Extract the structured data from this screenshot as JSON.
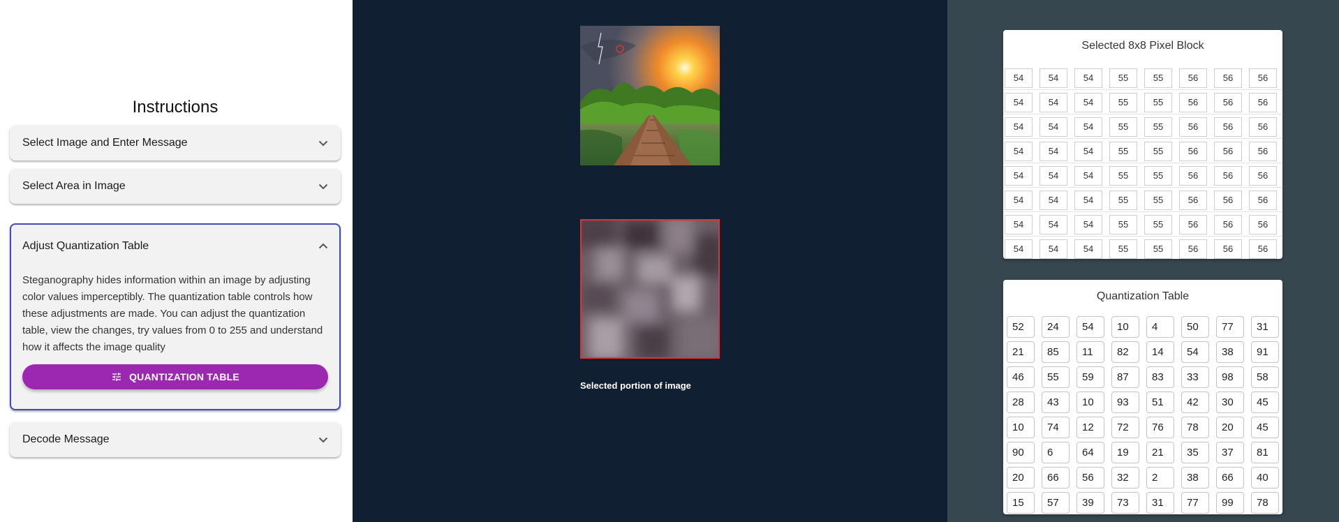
{
  "instructions": {
    "title": "Instructions",
    "sections": [
      {
        "label": "Select Image and Enter Message",
        "expanded": false
      },
      {
        "label": "Select Area in Image",
        "expanded": false
      },
      {
        "label": "Adjust Quantization Table",
        "expanded": true,
        "body": "Steganography hides information within an image by adjusting color values imperceptibly. The quantization table controls how these adjustments are made. You can adjust the quantization table, view the changes, try values from 0 to 255 and understand how it affects the image quality",
        "button_label": "QUANTIZATION TABLE",
        "button_icon": "tune-icon"
      },
      {
        "label": "Decode Message",
        "expanded": false
      }
    ]
  },
  "viewer": {
    "selected_caption": "Selected portion of image"
  },
  "pixel_block": {
    "title": "Selected 8x8 Pixel Block",
    "rows": [
      [
        54,
        54,
        54,
        55,
        55,
        56,
        56,
        56
      ],
      [
        54,
        54,
        54,
        55,
        55,
        56,
        56,
        56
      ],
      [
        54,
        54,
        54,
        55,
        55,
        56,
        56,
        56
      ],
      [
        54,
        54,
        54,
        55,
        55,
        56,
        56,
        56
      ],
      [
        54,
        54,
        54,
        55,
        55,
        56,
        56,
        56
      ],
      [
        54,
        54,
        54,
        55,
        55,
        56,
        56,
        56
      ],
      [
        54,
        54,
        54,
        55,
        55,
        56,
        56,
        56
      ],
      [
        54,
        54,
        54,
        55,
        55,
        56,
        56,
        56
      ]
    ]
  },
  "quantization_table": {
    "title": "Quantization Table",
    "rows": [
      [
        52,
        24,
        54,
        10,
        4,
        50,
        77,
        31
      ],
      [
        21,
        85,
        11,
        82,
        14,
        54,
        38,
        91
      ],
      [
        46,
        55,
        59,
        87,
        83,
        33,
        98,
        58
      ],
      [
        28,
        43,
        10,
        93,
        51,
        42,
        30,
        45
      ],
      [
        10,
        74,
        12,
        72,
        76,
        78,
        20,
        45
      ],
      [
        90,
        6,
        64,
        19,
        21,
        35,
        37,
        81
      ],
      [
        20,
        66,
        56,
        32,
        2,
        38,
        66,
        40
      ],
      [
        15,
        57,
        39,
        73,
        31,
        77,
        99,
        78
      ]
    ]
  },
  "colors": {
    "center_bg": "#111f33",
    "right_bg": "#37474f",
    "accent_purple": "#9c27b0",
    "selection_red": "#e0332e"
  }
}
